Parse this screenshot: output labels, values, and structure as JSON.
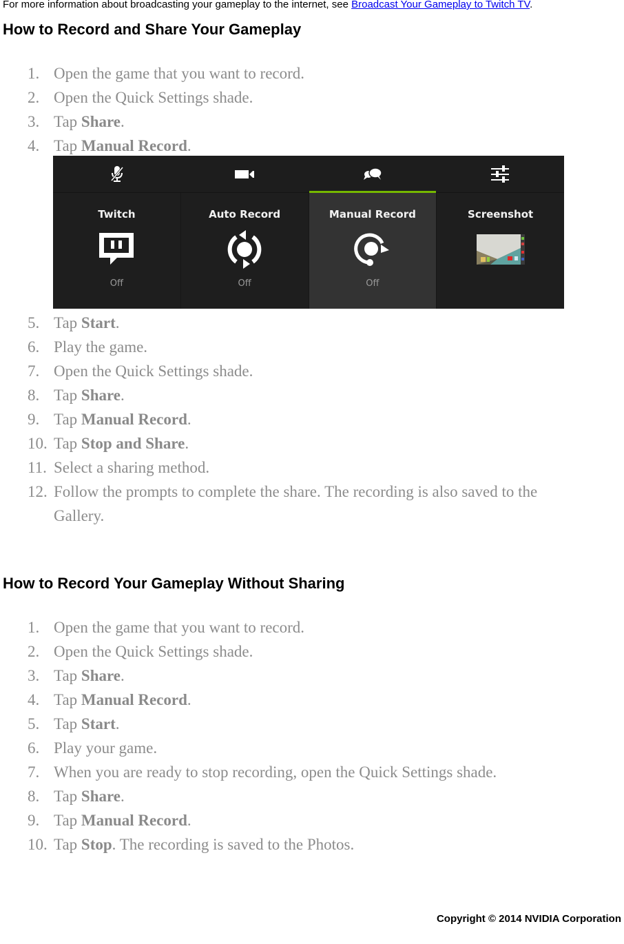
{
  "intro": {
    "text": "For more information about broadcasting your gameplay to the internet, see ",
    "link": "Broadcast Your Gameplay to Twitch TV",
    "suffix": "."
  },
  "section1": {
    "title": "How to Record and Share Your Gameplay",
    "steps_before": [
      {
        "num": "1.",
        "pre": "Open the game that you want to record.",
        "bold": "",
        "post": ""
      },
      {
        "num": "2.",
        "pre": "Open the Quick Settings shade.",
        "bold": "",
        "post": ""
      },
      {
        "num": "3.",
        "pre": "Tap ",
        "bold": "Share",
        "post": "."
      },
      {
        "num": "4.",
        "pre": "Tap ",
        "bold": "Manual Record",
        "post": "."
      }
    ],
    "steps_after": [
      {
        "num": "5.",
        "pre": "Tap ",
        "bold": "Start",
        "post": "."
      },
      {
        "num": "6.",
        "pre": "Play the game.",
        "bold": "",
        "post": ""
      },
      {
        "num": "7.",
        "pre": "Open the Quick Settings shade.",
        "bold": "",
        "post": ""
      },
      {
        "num": "8.",
        "pre": "Tap ",
        "bold": "Share",
        "post": "."
      },
      {
        "num": "9.",
        "pre": "Tap ",
        "bold": "Manual Record",
        "post": "."
      },
      {
        "num": "10.",
        "pre": "Tap ",
        "bold": "Stop and Share",
        "post": "."
      },
      {
        "num": "11.",
        "pre": "Select a sharing method.",
        "bold": "",
        "post": ""
      },
      {
        "num": "12.",
        "pre": "Follow the prompts to complete the share. The recording is also saved to the Gallery.",
        "bold": "",
        "post": ""
      }
    ]
  },
  "screenshot": {
    "top_icons": [
      "mic-muted-icon",
      "video-camera-icon",
      "chat-bubbles-icon",
      "sliders-icon"
    ],
    "tiles": [
      {
        "label": "Twitch",
        "icon": "twitch-icon",
        "status": "Off",
        "active": false
      },
      {
        "label": "Auto Record",
        "icon": "auto-record-icon",
        "status": "Off",
        "active": false
      },
      {
        "label": "Manual Record",
        "icon": "manual-record-icon",
        "status": "Off",
        "active": true
      },
      {
        "label": "Screenshot",
        "icon": "screenshot-thumbnail",
        "status": "",
        "active": false
      }
    ],
    "accent_color": "#76b900"
  },
  "section2": {
    "title": "How to Record Your Gameplay Without Sharing",
    "steps": [
      {
        "num": "1.",
        "pre": "Open the game that you want to record.",
        "bold": "",
        "post": ""
      },
      {
        "num": "2.",
        "pre": "Open the Quick Settings shade.",
        "bold": "",
        "post": ""
      },
      {
        "num": "3.",
        "pre": "Tap ",
        "bold": "Share",
        "post": "."
      },
      {
        "num": "4.",
        "pre": "Tap ",
        "bold": "Manual Record",
        "post": "."
      },
      {
        "num": "5.",
        "pre": "Tap ",
        "bold": "Start",
        "post": "."
      },
      {
        "num": "6.",
        "pre": "Play your game.",
        "bold": "",
        "post": ""
      },
      {
        "num": "7.",
        "pre": "When you are ready to stop recording, open the Quick Settings shade.",
        "bold": "",
        "post": ""
      },
      {
        "num": "8.",
        "pre": "Tap ",
        "bold": "Share",
        "post": "."
      },
      {
        "num": "9.",
        "pre": "Tap ",
        "bold": "Manual Record",
        "post": "."
      },
      {
        "num": "10.",
        "pre": "Tap ",
        "bold": "Stop",
        "post": ". The recording is saved to the Photos."
      }
    ]
  },
  "footer": {
    "copyright": "Copyright © 2014 NVIDIA Corporation"
  }
}
